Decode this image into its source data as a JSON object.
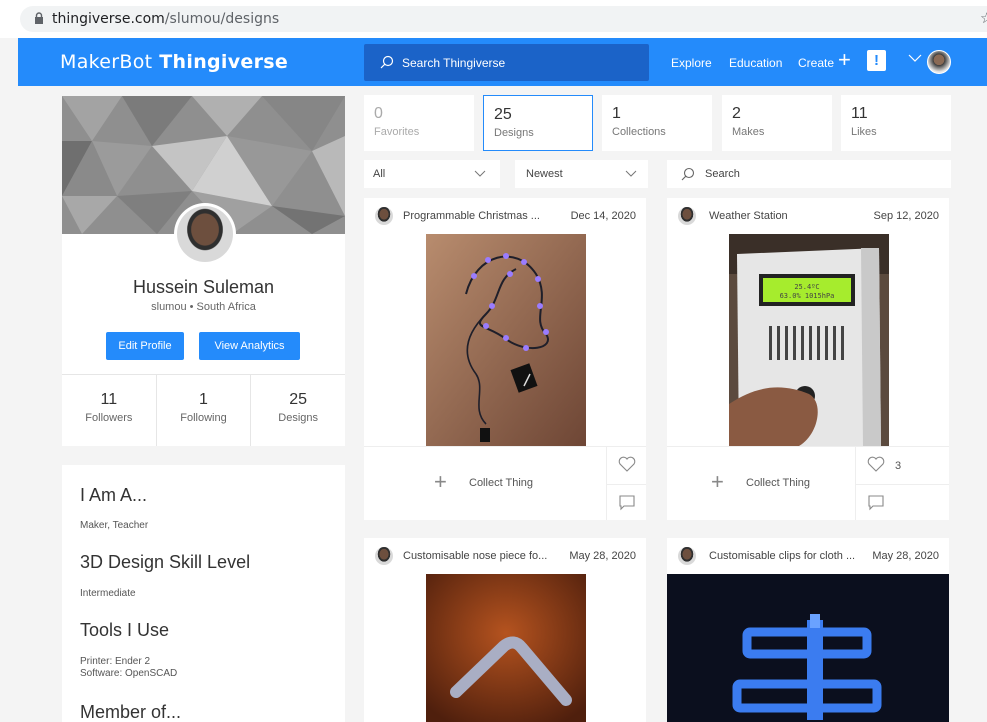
{
  "browser": {
    "url_host": "thingiverse.com",
    "url_path": "/slumou/designs"
  },
  "header": {
    "logo_maker": "MakerBot",
    "logo_thing": "Thingiverse",
    "search_placeholder": "Search Thingiverse",
    "nav": [
      "Explore",
      "Education",
      "Create"
    ],
    "plus": "+",
    "alert": "!"
  },
  "profile": {
    "name": "Hussein Suleman",
    "subtitle": "slumou • South Africa",
    "edit_label": "Edit Profile",
    "analytics_label": "View Analytics",
    "stats": [
      {
        "value": "11",
        "label": "Followers"
      },
      {
        "value": "1",
        "label": "Following"
      },
      {
        "value": "25",
        "label": "Designs"
      }
    ]
  },
  "about": {
    "iam_heading": "I Am A...",
    "iam_text": "Maker, Teacher",
    "skill_heading": "3D Design Skill Level",
    "skill_text": "Intermediate",
    "tools_heading": "Tools I Use",
    "tools_printer": "Printer: Ender 2",
    "tools_software": "Software: OpenSCAD",
    "member_heading": "Member of..."
  },
  "tabs": [
    {
      "value": "0",
      "label": "Favorites"
    },
    {
      "value": "25",
      "label": "Designs"
    },
    {
      "value": "1",
      "label": "Collections"
    },
    {
      "value": "2",
      "label": "Makes"
    },
    {
      "value": "11",
      "label": "Likes"
    }
  ],
  "filters": {
    "type": "All",
    "sort": "Newest",
    "search_placeholder": "Search"
  },
  "things": [
    {
      "title": "Programmable Christmas ...",
      "date": "Dec 14, 2020",
      "collect": "Collect Thing",
      "likes": ""
    },
    {
      "title": "Weather Station",
      "date": "Sep 12, 2020",
      "collect": "Collect Thing",
      "likes": "3",
      "lcd_line1": "25.4ºC",
      "lcd_line2": "63.0% 1015hPa"
    },
    {
      "title": "Customisable nose piece fo...",
      "date": "May 28, 2020"
    },
    {
      "title": "Customisable clips for cloth ...",
      "date": "May 28, 2020"
    }
  ],
  "colors": {
    "brand": "#248bfb",
    "search_bg": "#1b63c8",
    "page_bg": "#f4f4f4"
  }
}
